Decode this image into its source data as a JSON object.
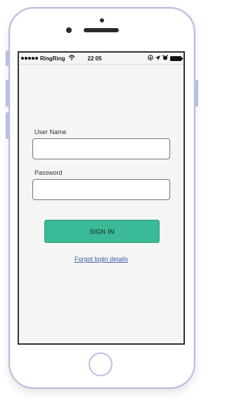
{
  "statusbar": {
    "carrier": "RingRing",
    "time": "22 05",
    "signal_icon": "signal-dots-icon",
    "wifi_icon": "wifi-icon",
    "lock_icon": "rotation-lock-icon",
    "location_icon": "location-arrow-icon",
    "alarm_icon": "alarm-clock-icon",
    "battery_icon": "battery-icon"
  },
  "login": {
    "username_label": "User Name",
    "username_value": "",
    "password_label": "Password",
    "password_value": "",
    "signin_label": "SIGN IN",
    "forgot_label": "Forgot login details"
  },
  "colors": {
    "accent": "#3aba96",
    "link": "#3c5da8",
    "screen_bg": "#f5f5f5",
    "frame": "#b9c0dc"
  }
}
